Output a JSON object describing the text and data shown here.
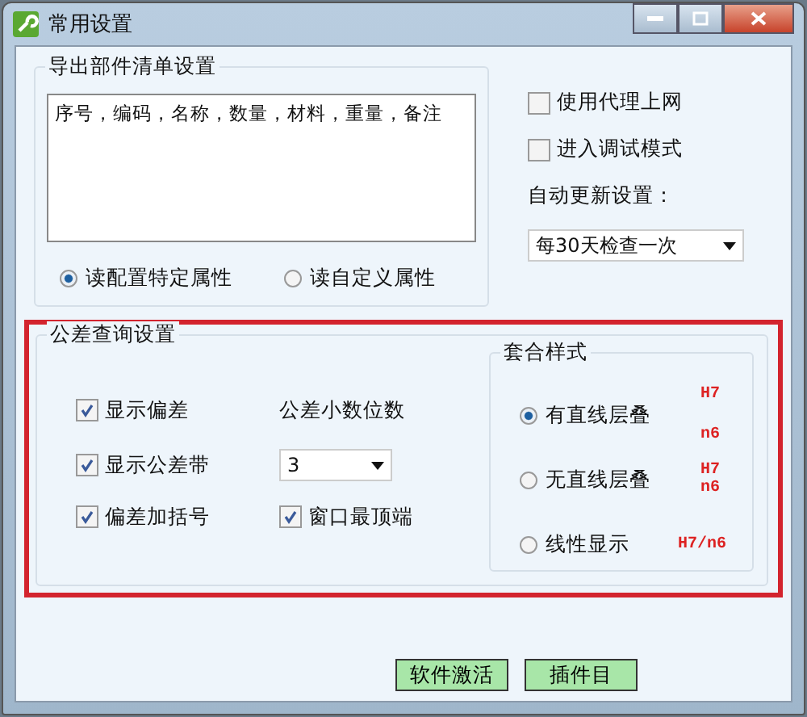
{
  "window": {
    "title": "常用设置"
  },
  "export_group": {
    "title": "导出部件清单设置",
    "fields_text": "序号，编码，名称，数量，材料，重量，备注",
    "radios": [
      {
        "label": "读配置特定属性",
        "selected": true
      },
      {
        "label": "读自定义属性",
        "selected": false
      }
    ]
  },
  "options": {
    "checkboxes": [
      {
        "label": "使用代理上网",
        "checked": false
      },
      {
        "label": "进入调试模式",
        "checked": false
      }
    ],
    "update_label": "自动更新设置：",
    "update_value": "每30天检查一次"
  },
  "tolerance_group": {
    "title": "公差查询设置",
    "highlighted": true,
    "checkboxes": [
      {
        "label": "显示偏差",
        "checked": true
      },
      {
        "label": "显示公差带",
        "checked": true
      },
      {
        "label": "偏差加括号",
        "checked": true
      }
    ],
    "decimals_label": "公差小数位数",
    "decimals_value": "3",
    "topmost": {
      "label": "窗口最顶端",
      "checked": true
    },
    "fit_style": {
      "title": "套合样式",
      "options": [
        {
          "label": "有直线层叠",
          "selected": true,
          "sample": [
            "H7",
            "n6"
          ],
          "kind": "stacked-wide"
        },
        {
          "label": "无直线层叠",
          "selected": false,
          "sample": [
            "H7",
            "n6"
          ],
          "kind": "stacked"
        },
        {
          "label": "线性显示",
          "selected": false,
          "sample": [
            "H7/n6"
          ],
          "kind": "inline"
        }
      ]
    }
  },
  "buttons": [
    "软件激活",
    "插件目"
  ]
}
